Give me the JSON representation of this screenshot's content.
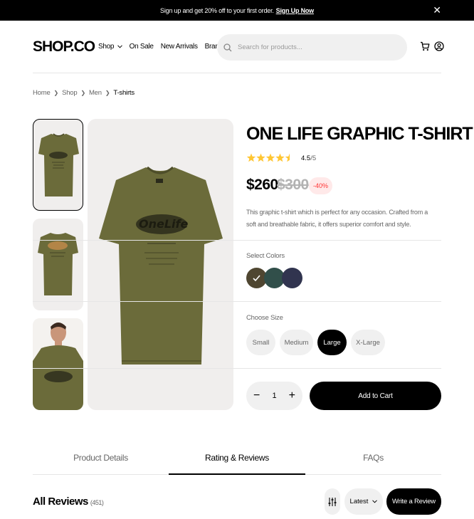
{
  "banner": {
    "text": "Sign up and get 20% off to your first order.",
    "link": "Sign Up Now",
    "close_icon": "close-icon"
  },
  "header": {
    "logo": "SHOP.CO",
    "nav": [
      "Shop",
      "On Sale",
      "New Arrivals",
      "Brands"
    ],
    "search_placeholder": "Search for products...",
    "icons": [
      "cart-icon",
      "account-icon"
    ]
  },
  "breadcrumb": [
    "Home",
    "Shop",
    "Men",
    "T-shirts"
  ],
  "gallery": {
    "thumbnails": [
      "t-shirt front",
      "t-shirt back",
      "model wearing t-shirt"
    ],
    "selected_index": 0
  },
  "product": {
    "title": "ONE LIFE GRAPHIC T-SHIRT",
    "rating_value": "4.5",
    "rating_max": "/5",
    "rating_fraction": 0.9,
    "price": "$260",
    "old_price": "$300",
    "discount": "-40%",
    "description": "This graphic t-shirt which is perfect for any occasion. Crafted from a soft and breathable fabric, it offers superior comfort and style.",
    "colors_label": "Select Colors",
    "colors": [
      "#4f4631",
      "#314f4a",
      "#31344f"
    ],
    "selected_color": 0,
    "size_label": "Choose Size",
    "sizes": [
      "Small",
      "Medium",
      "Large",
      "X-Large"
    ],
    "selected_size": 2,
    "quantity": "1",
    "add_to_cart": "Add to Cart"
  },
  "tabs": [
    "Product Details",
    "Rating & Reviews",
    "FAQs"
  ],
  "active_tab": 1,
  "reviews": {
    "title": "All Reviews",
    "count": "(451)",
    "sort": "Latest",
    "write": "Write a Review"
  }
}
